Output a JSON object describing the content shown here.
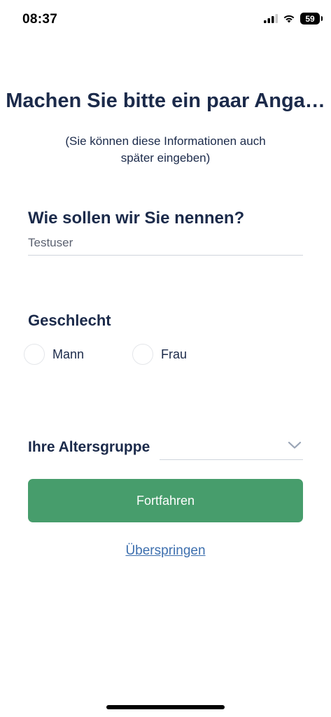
{
  "status_bar": {
    "time": "08:37",
    "battery_level": "59"
  },
  "screen": {
    "title": "Machen Sie bitte ein paar Anga…",
    "subtitle_line1": "(Sie können diese Informationen auch",
    "subtitle_line2": "später eingeben)"
  },
  "name_section": {
    "label": "Wie sollen wir Sie nennen?",
    "value": "Testuser"
  },
  "gender_section": {
    "label": "Geschlecht",
    "options": [
      {
        "label": "Mann",
        "selected": false
      },
      {
        "label": "Frau",
        "selected": false
      }
    ]
  },
  "age_section": {
    "label": "Ihre Altersgruppe",
    "selected_value": ""
  },
  "actions": {
    "continue_label": "Fortfahren",
    "skip_label": "Überspringen"
  },
  "colors": {
    "primary_button": "#479d6c",
    "heading_text": "#1b2a4a",
    "link": "#3d6fae"
  }
}
